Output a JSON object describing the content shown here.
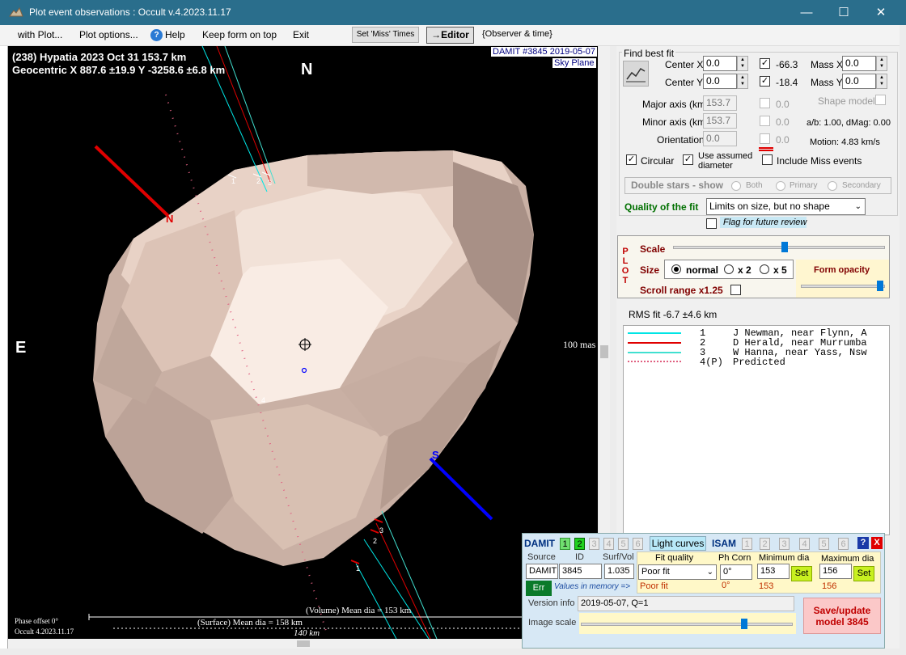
{
  "window": {
    "title": "Plot event observations : Occult v.4.2023.11.17",
    "minimize": "—",
    "maximize": "☐",
    "close": "✕"
  },
  "menu": {
    "with_plot": "with Plot...",
    "plot_options": "Plot options...",
    "help": "Help",
    "keep_on_top": "Keep form on top",
    "exit": "Exit",
    "set_miss": "Set 'Miss' Times",
    "editor": "→Editor",
    "observer_time": "{Observer & time}"
  },
  "plot": {
    "header1": "(238) Hypatia  2023 Oct 31   153.7 km",
    "header2": "Geocentric  X  887.6 ±19.9  Y -3258.6 ±6.8 km",
    "damit_tag": "DAMIT #3845 2019-05-07",
    "sky_plane": "Sky Plane",
    "north": "N",
    "east": "E",
    "pole_n": "N",
    "pole_s": "S",
    "scale_label": "100 mas",
    "phase_offset": "Phase offset 0°",
    "version": "Occult 4.2023.11.17",
    "volume_dia": "(Volume) Mean dia = 153 km",
    "surface_dia": "(Surface) Mean dia = 158 km",
    "km_scale": "140 km",
    "chord_labels": [
      "1",
      "2",
      "3",
      "1",
      "2",
      "3",
      "4"
    ]
  },
  "fit": {
    "group_title": "Find best fit",
    "center_x_label": "Center X",
    "center_x": "0.0",
    "center_y_label": "Center Y",
    "center_y": "0.0",
    "cx_check_value": "-66.3",
    "cy_check_value": "-18.4",
    "mass_x_label": "Mass X",
    "mass_x": "0.0",
    "mass_y_label": "Mass Y",
    "mass_y": "0.0",
    "major_label": "Major axis (km)",
    "major": "153.7",
    "major_chk": "0.0",
    "minor_label": "Minor axis (km)",
    "minor": "153.7",
    "minor_chk": "0.0",
    "orient_label": "Orientation",
    "orient": "0.0",
    "orient_chk": "0.0",
    "shape_model": "Shape model",
    "ab_dmag": "a/b: 1.00, dMag: 0.00",
    "motion": "Motion: 4.83 km/s",
    "circular": "Circular",
    "use_assumed_1": "Use assumed",
    "use_assumed_2": "diameter",
    "include_miss": "Include Miss events",
    "double_stars": "Double stars - show",
    "both": "Both",
    "primary": "Primary",
    "secondary": "Secondary",
    "quality_label": "Quality of the fit",
    "quality_value": "Limits on size, but no shape",
    "flag_review": "Flag for future review"
  },
  "plotctl": {
    "p": "P",
    "l": "L",
    "o": "O",
    "t": "T",
    "scale": "Scale",
    "size": "Size",
    "normal": "normal",
    "x2": "x 2",
    "x5": "x 5",
    "form_opacity": "Form opacity",
    "scroll_range": "Scroll range x1.25"
  },
  "rms": "RMS fit -6.7 ±4.6 km",
  "legend": [
    {
      "num": "1",
      "text": "J Newman, near Flynn, A",
      "color": "#00e5e5",
      "style": "solid"
    },
    {
      "num": "2",
      "text": "D Herald, near Murrumba",
      "color": "#e00000",
      "style": "solid"
    },
    {
      "num": "3",
      "text": "W Hanna, near Yass, Nsw",
      "color": "#40e0d0",
      "style": "solid"
    },
    {
      "num": "4(P)",
      "text": "Predicted",
      "color": "#e06080",
      "style": "dotted"
    }
  ],
  "damit": {
    "title": "DAMIT",
    "tabs": [
      "1",
      "2",
      "3",
      "4",
      "5",
      "6"
    ],
    "light_curves": "Light curves",
    "isam": "ISAM",
    "isam_tabs": [
      "1",
      "2",
      "3",
      "4",
      "5",
      "6"
    ],
    "help": "?",
    "close": "X",
    "source_label": "Source",
    "id_label": "ID",
    "surfvol_label": "Surf/Vol",
    "source": "DAMIT",
    "id": "3845",
    "surfvol": "1.035",
    "fit_quality_label": "Fit quality",
    "ph_corr_label": "Ph Corn",
    "min_dia_label": "Minimum dia",
    "max_dia_label": "Maximum dia",
    "fit_quality": "Poor fit",
    "ph_corr": "0°",
    "min_dia": "153",
    "max_dia": "156",
    "set": "Set",
    "fit_quality_mem": "Poor fit",
    "ph_corr_mem": "0°",
    "min_dia_mem": "153",
    "max_dia_mem": "156",
    "err": "Err",
    "values_in_memory": "Values in memory =>",
    "version_label": "Version info",
    "version": "2019-05-07, Q=1",
    "image_scale": "Image scale",
    "save_update": "Save/update model 3845"
  }
}
